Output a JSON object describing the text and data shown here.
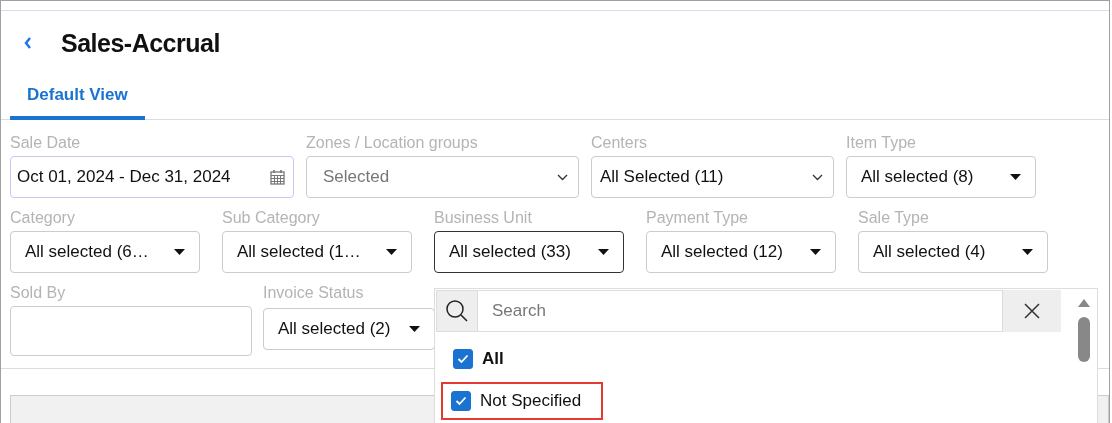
{
  "header": {
    "title": "Sales-Accrual"
  },
  "tabs": [
    {
      "label": "Default View",
      "selected": true
    }
  ],
  "filter_rows": [
    {
      "filters": [
        {
          "label": "Sale Date",
          "kind": "date",
          "value": "Oct 01, 2024 - Dec 31, 2024"
        },
        {
          "label": "Zones / Location groups",
          "kind": "select",
          "placeholder": "Selected"
        },
        {
          "label": "Centers",
          "kind": "select",
          "value": "All Selected (11)"
        },
        {
          "label": "Item Type",
          "kind": "dropdown",
          "value": "All selected (8)",
          "open": false
        }
      ]
    },
    {
      "filters": [
        {
          "label": "Category",
          "kind": "dropdown",
          "value": "All selected (6…",
          "open": false
        },
        {
          "label": "Sub Category",
          "kind": "dropdown",
          "value": "All selected (1…",
          "open": false
        },
        {
          "label": "Business Unit",
          "kind": "dropdown",
          "value": "All selected (33)",
          "open": true
        },
        {
          "label": "Payment Type",
          "kind": "dropdown",
          "value": "All selected (12)",
          "open": false
        },
        {
          "label": "Sale Type",
          "kind": "dropdown",
          "value": "All selected (4)",
          "open": false
        }
      ]
    },
    {
      "filters": [
        {
          "label": "Sold By",
          "kind": "text"
        },
        {
          "label": "Invoice Status",
          "kind": "dropdown",
          "value": "All selected (2)",
          "open": false
        }
      ]
    }
  ],
  "dropdown_menu": {
    "search_placeholder": "Search",
    "options": [
      {
        "label": "All",
        "kind": "select_all",
        "checked": true,
        "highlighted": false
      },
      {
        "label": "Not Specified",
        "kind": "option",
        "checked": true,
        "highlighted": true
      }
    ]
  }
}
